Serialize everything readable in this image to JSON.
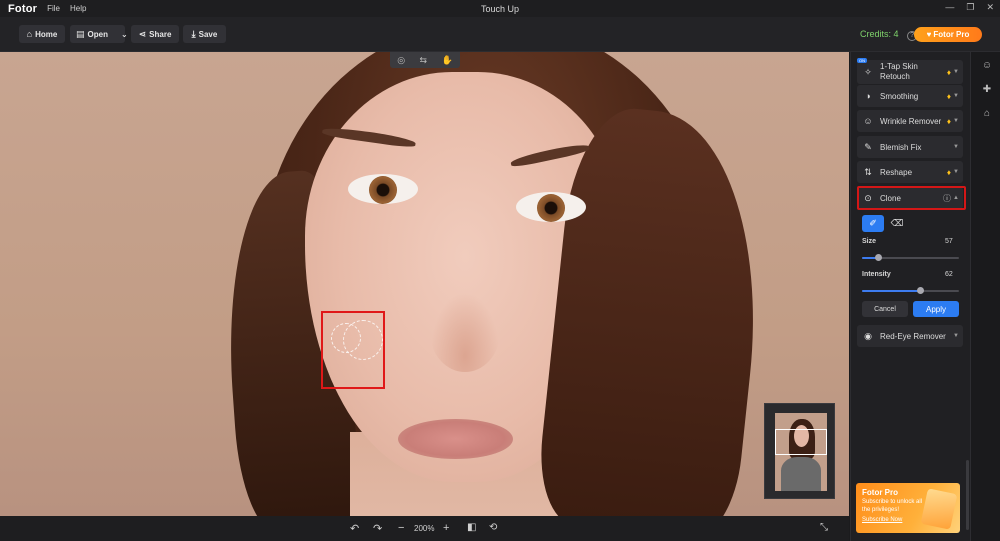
{
  "app": {
    "logo": "Fotor",
    "window_title": "Touch Up",
    "menu": [
      "File",
      "Help"
    ]
  },
  "toolbar": {
    "home": "Home",
    "open": "Open",
    "share": "Share",
    "save": "Save",
    "credits": "Credits: 4",
    "pro": "Fotor Pro"
  },
  "tools": [
    {
      "label": "1-Tap Skin Retouch",
      "badge": "ON",
      "premium": true
    },
    {
      "label": "Smoothing",
      "premium": true
    },
    {
      "label": "Wrinkle Remover",
      "premium": true
    },
    {
      "label": "Blemish Fix",
      "premium": false
    },
    {
      "label": "Reshape",
      "premium": true
    },
    {
      "label": "Clone",
      "premium": false,
      "expanded": true
    },
    {
      "label": "Red-Eye Remover",
      "premium": false
    }
  ],
  "clone": {
    "size_label": "Size",
    "size_value": "57",
    "size_fraction": 0.17,
    "intensity_label": "Intensity",
    "intensity_value": "62",
    "intensity_fraction": 0.6,
    "cancel": "Cancel",
    "apply": "Apply"
  },
  "zoom": {
    "value": "200%"
  },
  "promo": {
    "title": "Fotor Pro",
    "subtitle": "Subscribe to unlock all the privileges!",
    "link": "Subscribe Now"
  },
  "colors": {
    "accent": "#2c7cf2",
    "pro_orange": "#ff8d1a",
    "credits_green": "#7fd36b",
    "highlight_red": "#d41717"
  }
}
